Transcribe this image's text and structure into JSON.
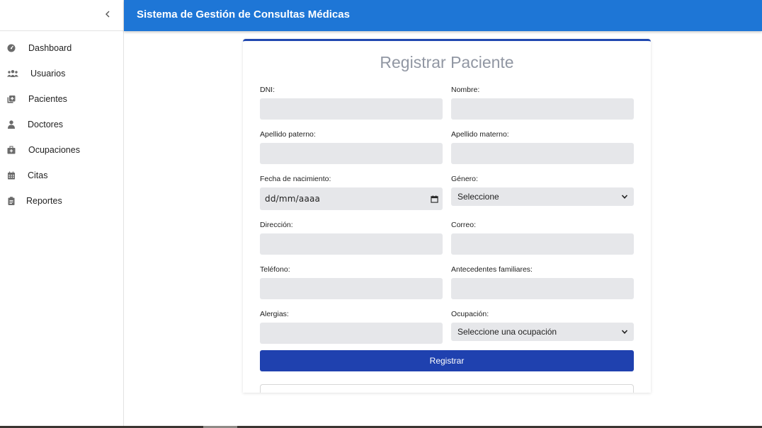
{
  "app": {
    "title": "Sistema de Gestión de Consultas Médicas",
    "accent_color": "#1e76d6",
    "button_color": "#1f41af"
  },
  "sidebar": {
    "collapse_icon": "chevron-left-icon",
    "items": [
      {
        "label": "Dashboard",
        "icon": "gauge-icon"
      },
      {
        "label": "Usuarios",
        "icon": "users-icon"
      },
      {
        "label": "Pacientes",
        "icon": "patient-add-icon"
      },
      {
        "label": "Doctores",
        "icon": "doctor-icon"
      },
      {
        "label": "Ocupaciones",
        "icon": "briefcase-medical-icon"
      },
      {
        "label": "Citas",
        "icon": "calendar-icon"
      },
      {
        "label": "Reportes",
        "icon": "clipboard-icon"
      }
    ]
  },
  "form": {
    "title": "Registrar Paciente",
    "fields": {
      "dni": {
        "label": "DNI:",
        "value": ""
      },
      "nombre": {
        "label": "Nombre:",
        "value": ""
      },
      "apellido_paterno": {
        "label": "Apellido paterno:",
        "value": ""
      },
      "apellido_materno": {
        "label": "Apellido materno:",
        "value": ""
      },
      "fecha_nacimiento": {
        "label": "Fecha de nacimiento:",
        "placeholder": "dd/mm/aaaa"
      },
      "genero": {
        "label": "Género:",
        "selected": "Seleccione"
      },
      "direccion": {
        "label": "Dirección:",
        "value": ""
      },
      "correo": {
        "label": "Correo:",
        "value": ""
      },
      "telefono": {
        "label": "Teléfono:",
        "value": ""
      },
      "antecedentes": {
        "label": "Antecedentes familiares:",
        "value": ""
      },
      "alergias": {
        "label": "Alergias:",
        "value": ""
      },
      "ocupacion": {
        "label": "Ocupación:",
        "selected": "Seleccione una ocupación"
      }
    },
    "submit_label": "Registrar"
  }
}
